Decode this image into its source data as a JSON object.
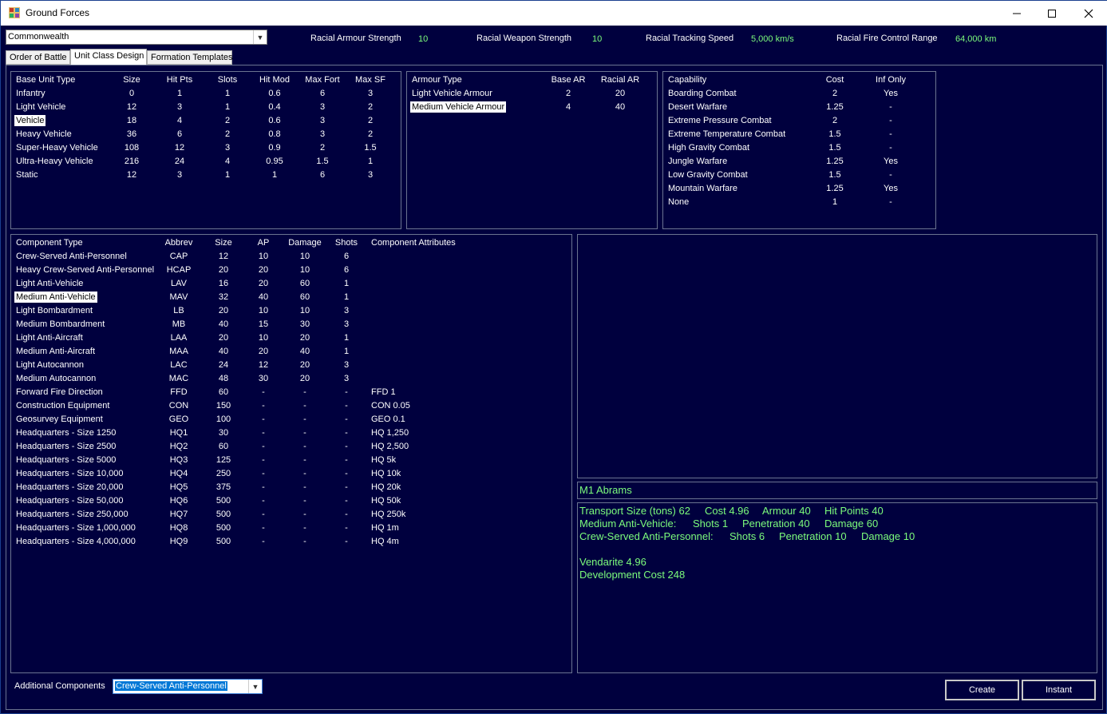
{
  "window": {
    "title": "Ground Forces",
    "minimize_icon": "minimize-icon",
    "maximize_icon": "maximize-icon",
    "close_icon": "close-icon"
  },
  "header": {
    "race_select": "Commonwealth",
    "stats": [
      {
        "label": "Racial Armour Strength",
        "value": "10"
      },
      {
        "label": "Racial  Weapon Strength",
        "value": "10"
      },
      {
        "label": "Racial  Tracking Speed",
        "value": "5,000 km/s"
      },
      {
        "label": "Racial Fire Control Range",
        "value": "64,000 km"
      }
    ]
  },
  "tabs": [
    "Order of Battle",
    "Unit Class Design",
    "Formation Templates"
  ],
  "active_tab": "Unit Class Design",
  "base_unit_table": {
    "headers": [
      "Base Unit Type",
      "Size",
      "Hit Pts",
      "Slots",
      "Hit Mod",
      "Max Fort",
      "Max SF"
    ],
    "rows": [
      [
        "Infantry",
        "0",
        "1",
        "1",
        "0.6",
        "6",
        "3"
      ],
      [
        "Light Vehicle",
        "12",
        "3",
        "1",
        "0.4",
        "3",
        "2"
      ],
      [
        "Vehicle",
        "18",
        "4",
        "2",
        "0.6",
        "3",
        "2"
      ],
      [
        "Heavy Vehicle",
        "36",
        "6",
        "2",
        "0.8",
        "3",
        "2"
      ],
      [
        "Super-Heavy Vehicle",
        "108",
        "12",
        "3",
        "0.9",
        "2",
        "1.5"
      ],
      [
        "Ultra-Heavy Vehicle",
        "216",
        "24",
        "4",
        "0.95",
        "1.5",
        "1"
      ],
      [
        "Static",
        "12",
        "3",
        "1",
        "1",
        "6",
        "3"
      ]
    ],
    "selected": "Vehicle"
  },
  "armour_table": {
    "headers": [
      "Armour Type",
      "Base AR",
      "Racial AR"
    ],
    "rows": [
      [
        "Light Vehicle Armour",
        "2",
        "20"
      ],
      [
        "Medium Vehicle Armour",
        "4",
        "40"
      ]
    ],
    "selected": "Medium Vehicle Armour"
  },
  "capability_table": {
    "headers": [
      "Capability",
      "Cost",
      "Inf Only"
    ],
    "rows": [
      [
        "Boarding Combat",
        "2",
        "Yes"
      ],
      [
        "Desert Warfare",
        "1.25",
        "-"
      ],
      [
        "Extreme Pressure Combat",
        "2",
        "-"
      ],
      [
        "Extreme Temperature Combat",
        "1.5",
        "-"
      ],
      [
        "High Gravity Combat",
        "1.5",
        "-"
      ],
      [
        "Jungle Warfare",
        "1.25",
        "Yes"
      ],
      [
        "Low Gravity Combat",
        "1.5",
        "-"
      ],
      [
        "Mountain Warfare",
        "1.25",
        "Yes"
      ],
      [
        "None",
        "1",
        "-"
      ]
    ]
  },
  "component_table": {
    "headers": [
      "Component Type",
      "Abbrev",
      "Size",
      "AP",
      "Damage",
      "Shots",
      "Component Attributes"
    ],
    "rows": [
      [
        "Crew-Served Anti-Personnel",
        "CAP",
        "12",
        "10",
        "10",
        "6",
        ""
      ],
      [
        "Heavy Crew-Served Anti-Personnel",
        "HCAP",
        "20",
        "20",
        "10",
        "6",
        ""
      ],
      [
        "Light Anti-Vehicle",
        "LAV",
        "16",
        "20",
        "60",
        "1",
        ""
      ],
      [
        "Medium Anti-Vehicle",
        "MAV",
        "32",
        "40",
        "60",
        "1",
        ""
      ],
      [
        "Light Bombardment",
        "LB",
        "20",
        "10",
        "10",
        "3",
        ""
      ],
      [
        "Medium Bombardment",
        "MB",
        "40",
        "15",
        "30",
        "3",
        ""
      ],
      [
        "Light Anti-Aircraft",
        "LAA",
        "20",
        "10",
        "20",
        "1",
        ""
      ],
      [
        "Medium Anti-Aircraft",
        "MAA",
        "40",
        "20",
        "40",
        "1",
        ""
      ],
      [
        "Light Autocannon",
        "LAC",
        "24",
        "12",
        "20",
        "3",
        ""
      ],
      [
        "Medium Autocannon",
        "MAC",
        "48",
        "30",
        "20",
        "3",
        ""
      ],
      [
        "Forward Fire Direction",
        "FFD",
        "60",
        "-",
        "-",
        "-",
        "FFD 1"
      ],
      [
        "Construction Equipment",
        "CON",
        "150",
        "-",
        "-",
        "-",
        "CON 0.05"
      ],
      [
        "Geosurvey Equipment",
        "GEO",
        "100",
        "-",
        "-",
        "-",
        "GEO 0.1"
      ],
      [
        "Headquarters - Size 1250",
        "HQ1",
        "30",
        "-",
        "-",
        "-",
        "HQ 1,250"
      ],
      [
        "Headquarters - Size 2500",
        "HQ2",
        "60",
        "-",
        "-",
        "-",
        "HQ 2,500"
      ],
      [
        "Headquarters - Size 5000",
        "HQ3",
        "125",
        "-",
        "-",
        "-",
        "HQ 5k"
      ],
      [
        "Headquarters - Size 10,000",
        "HQ4",
        "250",
        "-",
        "-",
        "-",
        "HQ 10k"
      ],
      [
        "Headquarters - Size 20,000",
        "HQ5",
        "375",
        "-",
        "-",
        "-",
        "HQ 20k"
      ],
      [
        "Headquarters - Size 50,000",
        "HQ6",
        "500",
        "-",
        "-",
        "-",
        "HQ 50k"
      ],
      [
        "Headquarters - Size 250,000",
        "HQ7",
        "500",
        "-",
        "-",
        "-",
        "HQ 250k"
      ],
      [
        "Headquarters - Size 1,000,000",
        "HQ8",
        "500",
        "-",
        "-",
        "-",
        "HQ 1m"
      ],
      [
        "Headquarters - Size 4,000,000",
        "HQ9",
        "500",
        "-",
        "-",
        "-",
        "HQ 4m"
      ]
    ],
    "selected": "Medium Anti-Vehicle"
  },
  "design": {
    "name": "M1 Abrams",
    "summary_lines": [
      [
        "Transport Size (tons)  62",
        "Cost  4.96",
        "Armour  40",
        "Hit Points  40"
      ],
      [
        "Medium Anti-Vehicle:",
        "Shots 1",
        "Penetration 40",
        "Damage 60"
      ],
      [
        "Crew-Served Anti-Personnel:",
        "Shots 6",
        "Penetration 10",
        "Damage 10"
      ]
    ],
    "mineral_line": "Vendarite  4.96",
    "dev_cost_line": "Development Cost  248"
  },
  "footer": {
    "additional_label": "Additional Components",
    "additional_value": "Crew-Served Anti-Personnel",
    "create_label": "Create",
    "instant_label": "Instant"
  },
  "colors": {
    "background": "#00003e",
    "info_text": "#7cfc7c",
    "panel_border": "#6b7490"
  }
}
